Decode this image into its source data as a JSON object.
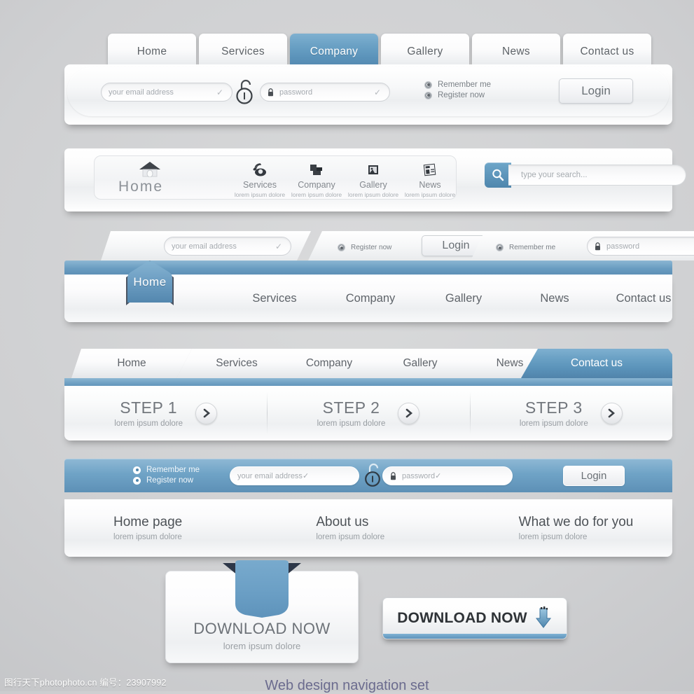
{
  "theme": {
    "accent": "#5d90b6",
    "accent_light": "#8bb6d3",
    "text": "#5f646a",
    "muted": "#9aa0a5"
  },
  "section1": {
    "tabs": [
      {
        "label": "Home",
        "active": false
      },
      {
        "label": "Services",
        "active": false
      },
      {
        "label": "Company",
        "active": true
      },
      {
        "label": "Gallery",
        "active": false
      },
      {
        "label": "News",
        "active": false
      },
      {
        "label": "Contact us",
        "active": false
      }
    ],
    "email_placeholder": "your email address",
    "password_placeholder": "password",
    "check_glyph": "✓",
    "lock_icon": "padlock-open-icon",
    "password_lock_icon": "padlock-closed-icon",
    "options": [
      "Remember me",
      "Register now"
    ],
    "login_label": "Login"
  },
  "section2": {
    "home_label": "Home",
    "home_icon": "house-icon",
    "items": [
      {
        "label": "Services",
        "sub": "lorem ipsum dolore",
        "icon": "telephone-icon"
      },
      {
        "label": "Company",
        "sub": "lorem ipsum dolore",
        "icon": "building-blocks-icon"
      },
      {
        "label": "Gallery",
        "sub": "lorem ipsum dolore",
        "icon": "picture-frame-icon"
      },
      {
        "label": "News",
        "sub": "lorem ipsum dolore",
        "icon": "newspaper-icon"
      }
    ],
    "search_placeholder": "type your search...",
    "search_icon": "magnifier-icon"
  },
  "section3": {
    "email_placeholder": "your email address",
    "password_placeholder": "password",
    "check_glyph": "✓",
    "option_register": "Register now",
    "option_remember": "Remember me",
    "login_label": "Login",
    "menu": [
      {
        "label": "Home",
        "active": true
      },
      {
        "label": "Services",
        "active": false
      },
      {
        "label": "Company",
        "active": false
      },
      {
        "label": "Gallery",
        "active": false
      },
      {
        "label": "News",
        "active": false
      },
      {
        "label": "Contact us",
        "active": false
      }
    ]
  },
  "section4": {
    "tabs": [
      {
        "label": "Home",
        "active": false
      },
      {
        "label": "Services",
        "active": false
      },
      {
        "label": "Company",
        "active": false
      },
      {
        "label": "Gallery",
        "active": false
      },
      {
        "label": "News",
        "active": false
      },
      {
        "label": "Contact us",
        "active": true
      }
    ],
    "steps": [
      {
        "title": "STEP 1",
        "sub": "lorem ipsum dolore",
        "arrow": "chevron-right-icon"
      },
      {
        "title": "STEP 2",
        "sub": "lorem ipsum dolore",
        "arrow": "chevron-right-icon"
      },
      {
        "title": "STEP 3",
        "sub": "lorem ipsum dolore",
        "arrow": "chevron-right-icon"
      }
    ]
  },
  "section5": {
    "option_remember": "Remember me",
    "option_register": "Register now",
    "email_placeholder": "your email address",
    "password_placeholder": "password",
    "check_glyph": "✓",
    "login_label": "Login",
    "links": [
      {
        "title": "Home page",
        "sub": "lorem ipsum dolore"
      },
      {
        "title": "About us",
        "sub": "lorem ipsum dolore"
      },
      {
        "title": "What we do for you",
        "sub": "lorem ipsum dolore"
      }
    ]
  },
  "download_card": {
    "title": "DOWNLOAD NOW",
    "sub": "lorem ipsum dolore",
    "ribbon_icon": "ribbon-bookmark-icon"
  },
  "download_button": {
    "label": "DOWNLOAD NOW",
    "icon": "download-arrow-icon"
  },
  "footer": {
    "watermark": "图行天下photophoto.cn  编号：23907992",
    "caption": "Web design navigation set"
  }
}
